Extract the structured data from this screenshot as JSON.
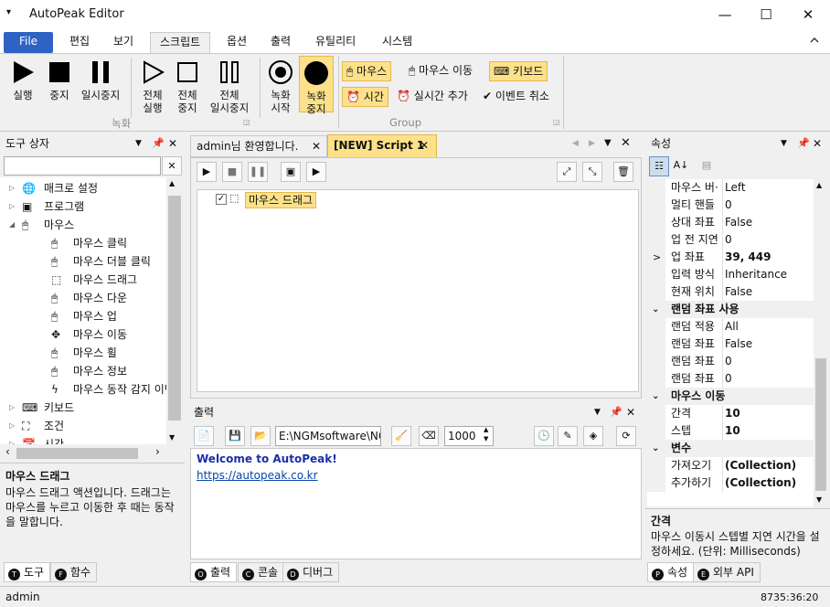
{
  "app": {
    "title": "AutoPeak Editor",
    "menu_icon": "▾"
  },
  "window": {
    "min": "—",
    "max": "☐",
    "close": "✕"
  },
  "menu": {
    "items": [
      "File",
      "편집",
      "보기",
      "스크립트",
      "옵션",
      "출력",
      "유틸리티",
      "시스템"
    ],
    "collapse_icon": "chevron-up-icon"
  },
  "ribbon": {
    "run": "실행",
    "stop": "중지",
    "pause": "일시중지",
    "run_all": [
      "전체",
      "실행"
    ],
    "stop_all": [
      "전체",
      "중지"
    ],
    "pause_all": [
      "전체",
      "일시중지"
    ],
    "rec_start": [
      "녹화",
      "시작"
    ],
    "rec_stop": [
      "녹화",
      "중지"
    ],
    "group_record": "녹화",
    "group_group": "Group",
    "mouse": "마우스",
    "mouse_move": "마우스 이동",
    "keyboard": "키보드",
    "time": "시간",
    "realtime_add": "실시간 추가",
    "event_cancel": "이벤트 취소"
  },
  "toolbox": {
    "title": "도구 상자",
    "search_placeholder": "",
    "items": [
      {
        "label": "매크로 설정",
        "icon": "globe-icon",
        "level": 0,
        "exp": "▷"
      },
      {
        "label": "프로그램",
        "icon": "program-icon",
        "level": 0,
        "exp": "▷"
      },
      {
        "label": "마우스",
        "icon": "mouse-icon",
        "level": 0,
        "exp": "◢"
      },
      {
        "label": "마우스 클릭",
        "icon": "mouse-click-icon",
        "level": 1
      },
      {
        "label": "마우스 더블 클릭",
        "icon": "mouse-double-click-icon",
        "level": 1
      },
      {
        "label": "마우스 드래그",
        "icon": "mouse-drag-icon",
        "level": 1
      },
      {
        "label": "마우스 다운",
        "icon": "mouse-down-icon",
        "level": 1
      },
      {
        "label": "마우스 업",
        "icon": "mouse-up-icon",
        "level": 1
      },
      {
        "label": "마우스 이동",
        "icon": "mouse-move-icon",
        "level": 1
      },
      {
        "label": "마우스 휠",
        "icon": "mouse-wheel-icon",
        "level": 1
      },
      {
        "label": "마우스 정보",
        "icon": "mouse-info-icon",
        "level": 1
      },
      {
        "label": "마우스 동작 감지 이벤",
        "icon": "lightning-icon",
        "level": 1
      },
      {
        "label": "키보드",
        "icon": "keyboard-icon",
        "level": 0,
        "exp": "▷"
      },
      {
        "label": "조건",
        "icon": "condition-icon",
        "level": 0,
        "exp": "▷"
      },
      {
        "label": "시간",
        "icon": "calendar-icon",
        "level": 0,
        "exp": "▷"
      }
    ],
    "desc_title": "마우스 드래그",
    "desc_text": "마우스 드래그 액션입니다. 드래그는 마우스를 누르고 이동한 후 때는 동작을 말합니다.",
    "tabs": [
      {
        "key": "T",
        "label": "도구"
      },
      {
        "key": "F",
        "label": "함수"
      }
    ]
  },
  "editor": {
    "tabs": [
      {
        "label": "admin님 환영합니다.",
        "close": "✕"
      },
      {
        "label": "[NEW] Script 1",
        "close": "✕"
      }
    ],
    "node_label": "마우스 드래그"
  },
  "output": {
    "title": "출력",
    "path": "E:\\NGMsoftware\\NG",
    "count": "1000",
    "welcome": "Welcome to AutoPeak!",
    "link": "https://autopeak.co.kr",
    "tabs": [
      {
        "key": "O",
        "label": "출력"
      },
      {
        "key": "C",
        "label": "콘솔"
      },
      {
        "key": "D",
        "label": "디버그"
      }
    ]
  },
  "properties": {
    "title": "속성",
    "rows": [
      {
        "type": "row",
        "name": "마우스 버·",
        "value": "Left"
      },
      {
        "type": "row",
        "name": "멀티 핸들",
        "value": "0"
      },
      {
        "type": "row",
        "name": "상대 좌표",
        "value": "False"
      },
      {
        "type": "row",
        "name": "업 전 지연",
        "value": "0"
      },
      {
        "type": "row",
        "name": "업 좌표",
        "value": "39, 449",
        "bold": true,
        "exp": ">"
      },
      {
        "type": "row",
        "name": "입력 방식",
        "value": "Inheritance"
      },
      {
        "type": "row",
        "name": "현재 위치",
        "value": "False"
      },
      {
        "type": "cat",
        "name": "랜덤 좌표 사용"
      },
      {
        "type": "row",
        "name": "랜덤 적용",
        "value": "All"
      },
      {
        "type": "row",
        "name": "랜덤 좌표",
        "value": "False"
      },
      {
        "type": "row",
        "name": "랜덤 좌표",
        "value": "0"
      },
      {
        "type": "row",
        "name": "랜덤 좌표",
        "value": "0"
      },
      {
        "type": "cat",
        "name": "마우스 이동"
      },
      {
        "type": "row",
        "name": "간격",
        "value": "10",
        "bold": true
      },
      {
        "type": "row",
        "name": "스텝",
        "value": "10",
        "bold": true
      },
      {
        "type": "cat",
        "name": "변수"
      },
      {
        "type": "row",
        "name": "가져오기",
        "value": "(Collection)",
        "bold": true
      },
      {
        "type": "row",
        "name": "추가하기",
        "value": "(Collection)",
        "bold": true
      }
    ],
    "desc_title": "간격",
    "desc_text": "마우스 이동시 스텝별 지연 시간을 설정하세요. (단위: Milliseconds)",
    "tabs": [
      {
        "key": "P",
        "label": "속성"
      },
      {
        "key": "E",
        "label": "외부 API"
      }
    ]
  },
  "status": {
    "user": "admin",
    "time": "8735:36:20"
  },
  "colors": {
    "accent": "#2e63c4",
    "highlight": "#fde18a",
    "link": "#0645ad"
  }
}
